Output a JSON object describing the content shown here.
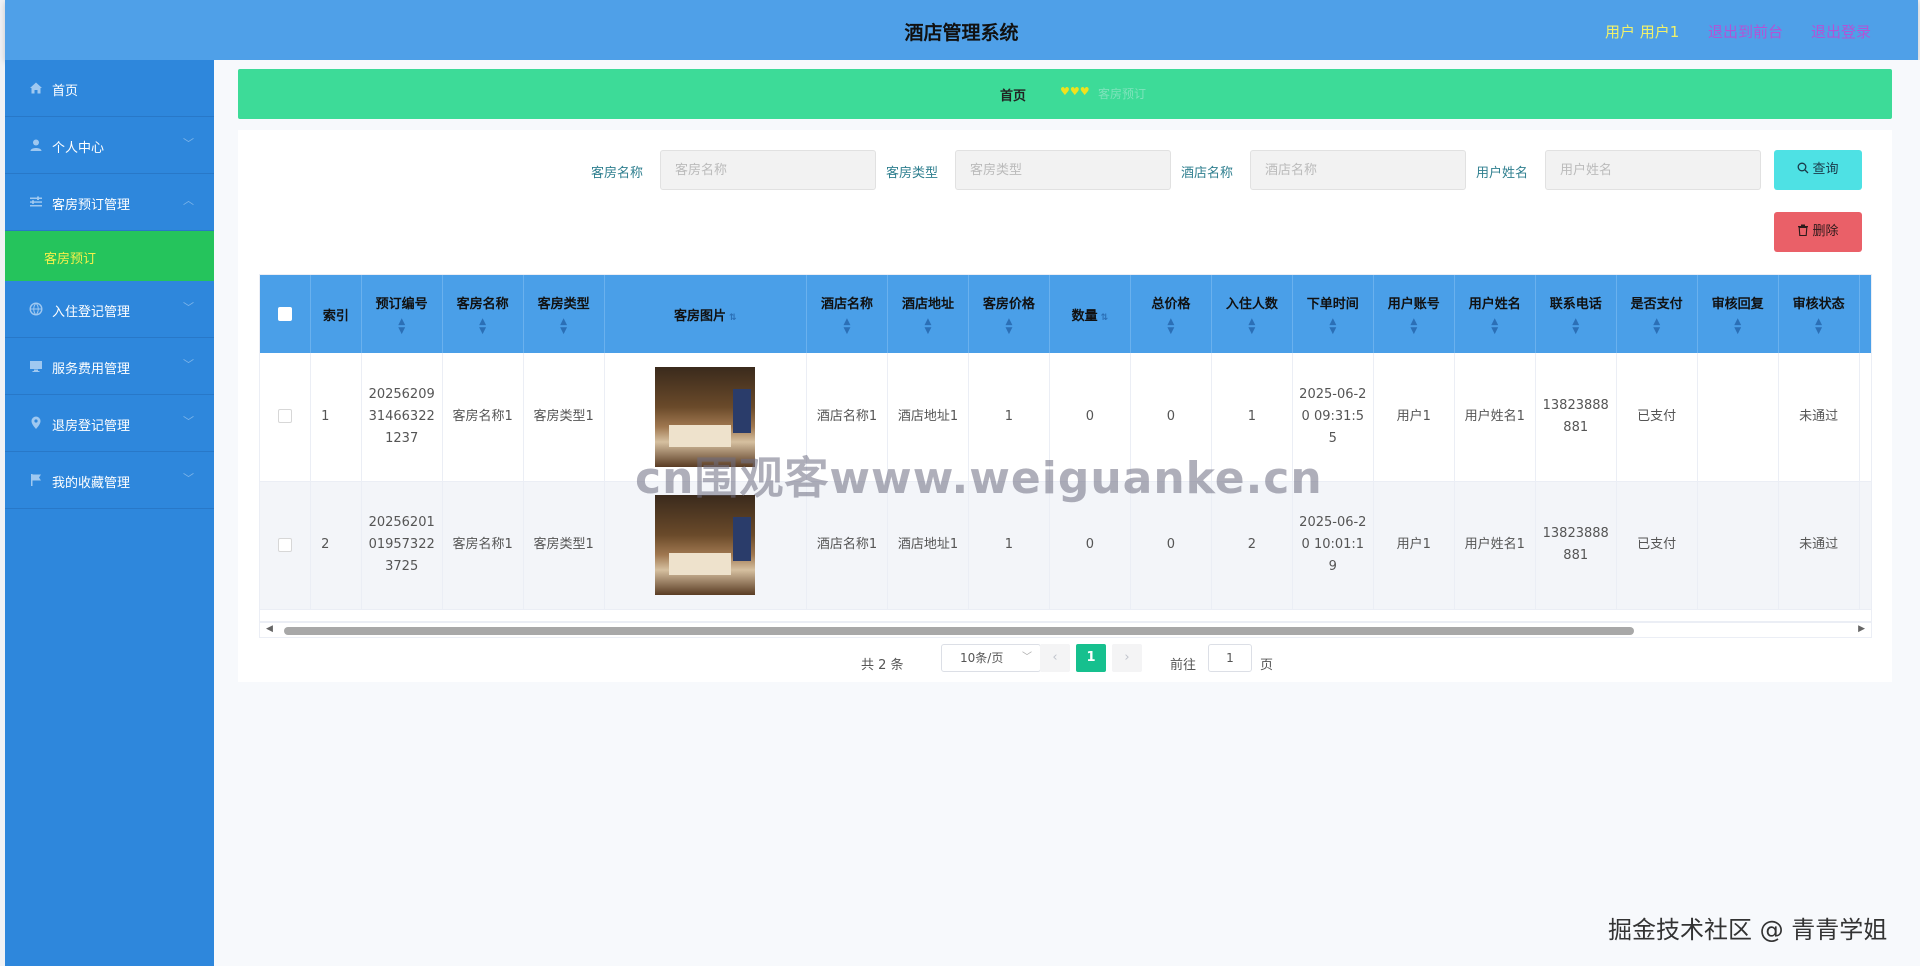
{
  "header": {
    "title": "酒店管理系统",
    "user": "用户 用户1",
    "back_to_front": "退出到前台",
    "logout": "退出登录"
  },
  "sidebar": {
    "items": [
      {
        "label": "首页",
        "icon": "home-icon",
        "expandable": false
      },
      {
        "label": "个人中心",
        "icon": "user-icon",
        "expandable": true
      },
      {
        "label": "客房预订管理",
        "icon": "sliders-icon",
        "expandable": true,
        "expanded": true
      },
      {
        "label": "入住登记管理",
        "icon": "globe-icon",
        "expandable": true
      },
      {
        "label": "服务费用管理",
        "icon": "monitor-icon",
        "expandable": true
      },
      {
        "label": "退房登记管理",
        "icon": "location-icon",
        "expandable": true
      },
      {
        "label": "我的收藏管理",
        "icon": "flag-icon",
        "expandable": true
      }
    ],
    "submenu": {
      "label": "客房预订"
    }
  },
  "breadcrumb": {
    "home": "首页",
    "hearts": "♥♥♥",
    "current": "客房预订"
  },
  "search": {
    "room_name": {
      "label": "客房名称",
      "placeholder": "客房名称",
      "value": ""
    },
    "room_type": {
      "label": "客房类型",
      "placeholder": "客房类型",
      "value": ""
    },
    "hotel_name": {
      "label": "酒店名称",
      "placeholder": "酒店名称",
      "value": ""
    },
    "user_name": {
      "label": "用户姓名",
      "placeholder": "用户姓名",
      "value": ""
    },
    "query_label": "查询",
    "delete_label": "删除"
  },
  "table": {
    "columns": [
      "索引",
      "预订编号",
      "客房名称",
      "客房类型",
      "客房图片",
      "酒店名称",
      "酒店地址",
      "客房价格",
      "数量",
      "总价格",
      "入住人数",
      "下单时间",
      "用户账号",
      "用户姓名",
      "联系电话",
      "是否支付",
      "审核回复",
      "审核状态"
    ],
    "rows": [
      {
        "index": "1",
        "order_no": "20256209314663221237",
        "room_name": "客房名称1",
        "room_type": "客房类型1",
        "hotel_name": "酒店名称1",
        "hotel_address": "酒店地址1",
        "price": "1",
        "quantity": "0",
        "total": "0",
        "guests": "1",
        "order_time": "2025-06-20 09:31:55",
        "account": "用户1",
        "user_name": "用户姓名1",
        "phone": "13823888881",
        "paid": "已支付",
        "reply": "",
        "status": "未通过"
      },
      {
        "index": "2",
        "order_no": "20256201019573223725",
        "room_name": "客房名称1",
        "room_type": "客房类型1",
        "hotel_name": "酒店名称1",
        "hotel_address": "酒店地址1",
        "price": "1",
        "quantity": "0",
        "total": "0",
        "guests": "2",
        "order_time": "2025-06-20 10:01:19",
        "account": "用户1",
        "user_name": "用户姓名1",
        "phone": "13823888881",
        "paid": "已支付",
        "reply": "",
        "status": "未通过"
      }
    ]
  },
  "pagination": {
    "total_text": "共 2 条",
    "page_size": "10条/页",
    "current_page": "1",
    "goto_label": "前往",
    "goto_value": "1",
    "page_unit": "页"
  },
  "watermark": "cn围观客www.weiguanke.cn",
  "corner_mark": "掘金技术社区 @ 青青学姐",
  "colors": {
    "header": "#4fa0e8",
    "sidebar": "#2e87dc",
    "submenu_active": "#25c45c",
    "breadcrumb": "#3ddb98",
    "query_button": "#4ee1e4",
    "delete_button": "#ea6068",
    "table_header": "#4a9fe8",
    "pager_active": "#16c08e"
  }
}
